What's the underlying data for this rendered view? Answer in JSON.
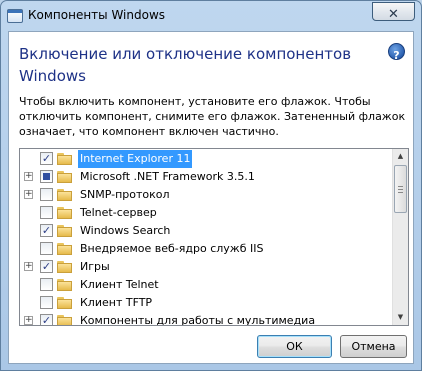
{
  "window": {
    "title": "Компоненты Windows",
    "close_label": "✕"
  },
  "heading": "Включение или отключение компонентов Windows",
  "help_label": "?",
  "description": "Чтобы включить компонент, установите его флажок. Чтобы отключить компонент, снимите его флажок. Затененный флажок означает, что компонент включен частично.",
  "features": [
    {
      "label": "Internet Explorer 11",
      "expandable": false,
      "state": "checked",
      "selected": true
    },
    {
      "label": "Microsoft .NET Framework 3.5.1",
      "expandable": true,
      "state": "partial",
      "selected": false
    },
    {
      "label": "SNMP-протокол",
      "expandable": true,
      "state": "unchecked",
      "selected": false
    },
    {
      "label": "Telnet-сервер",
      "expandable": false,
      "state": "unchecked",
      "selected": false
    },
    {
      "label": "Windows Search",
      "expandable": false,
      "state": "checked",
      "selected": false
    },
    {
      "label": "Внедряемое веб-ядро служб IIS",
      "expandable": false,
      "state": "unchecked",
      "selected": false
    },
    {
      "label": "Игры",
      "expandable": true,
      "state": "checked",
      "selected": false
    },
    {
      "label": "Клиент Telnet",
      "expandable": false,
      "state": "unchecked",
      "selected": false
    },
    {
      "label": "Клиент TFTP",
      "expandable": false,
      "state": "unchecked",
      "selected": false
    },
    {
      "label": "Компоненты для работы с мультимедиа",
      "expandable": true,
      "state": "checked",
      "selected": false
    }
  ],
  "buttons": {
    "ok": "ОК",
    "cancel": "Отмена"
  },
  "colors": {
    "heading": "#1e3287",
    "selection": "#3399ff"
  }
}
